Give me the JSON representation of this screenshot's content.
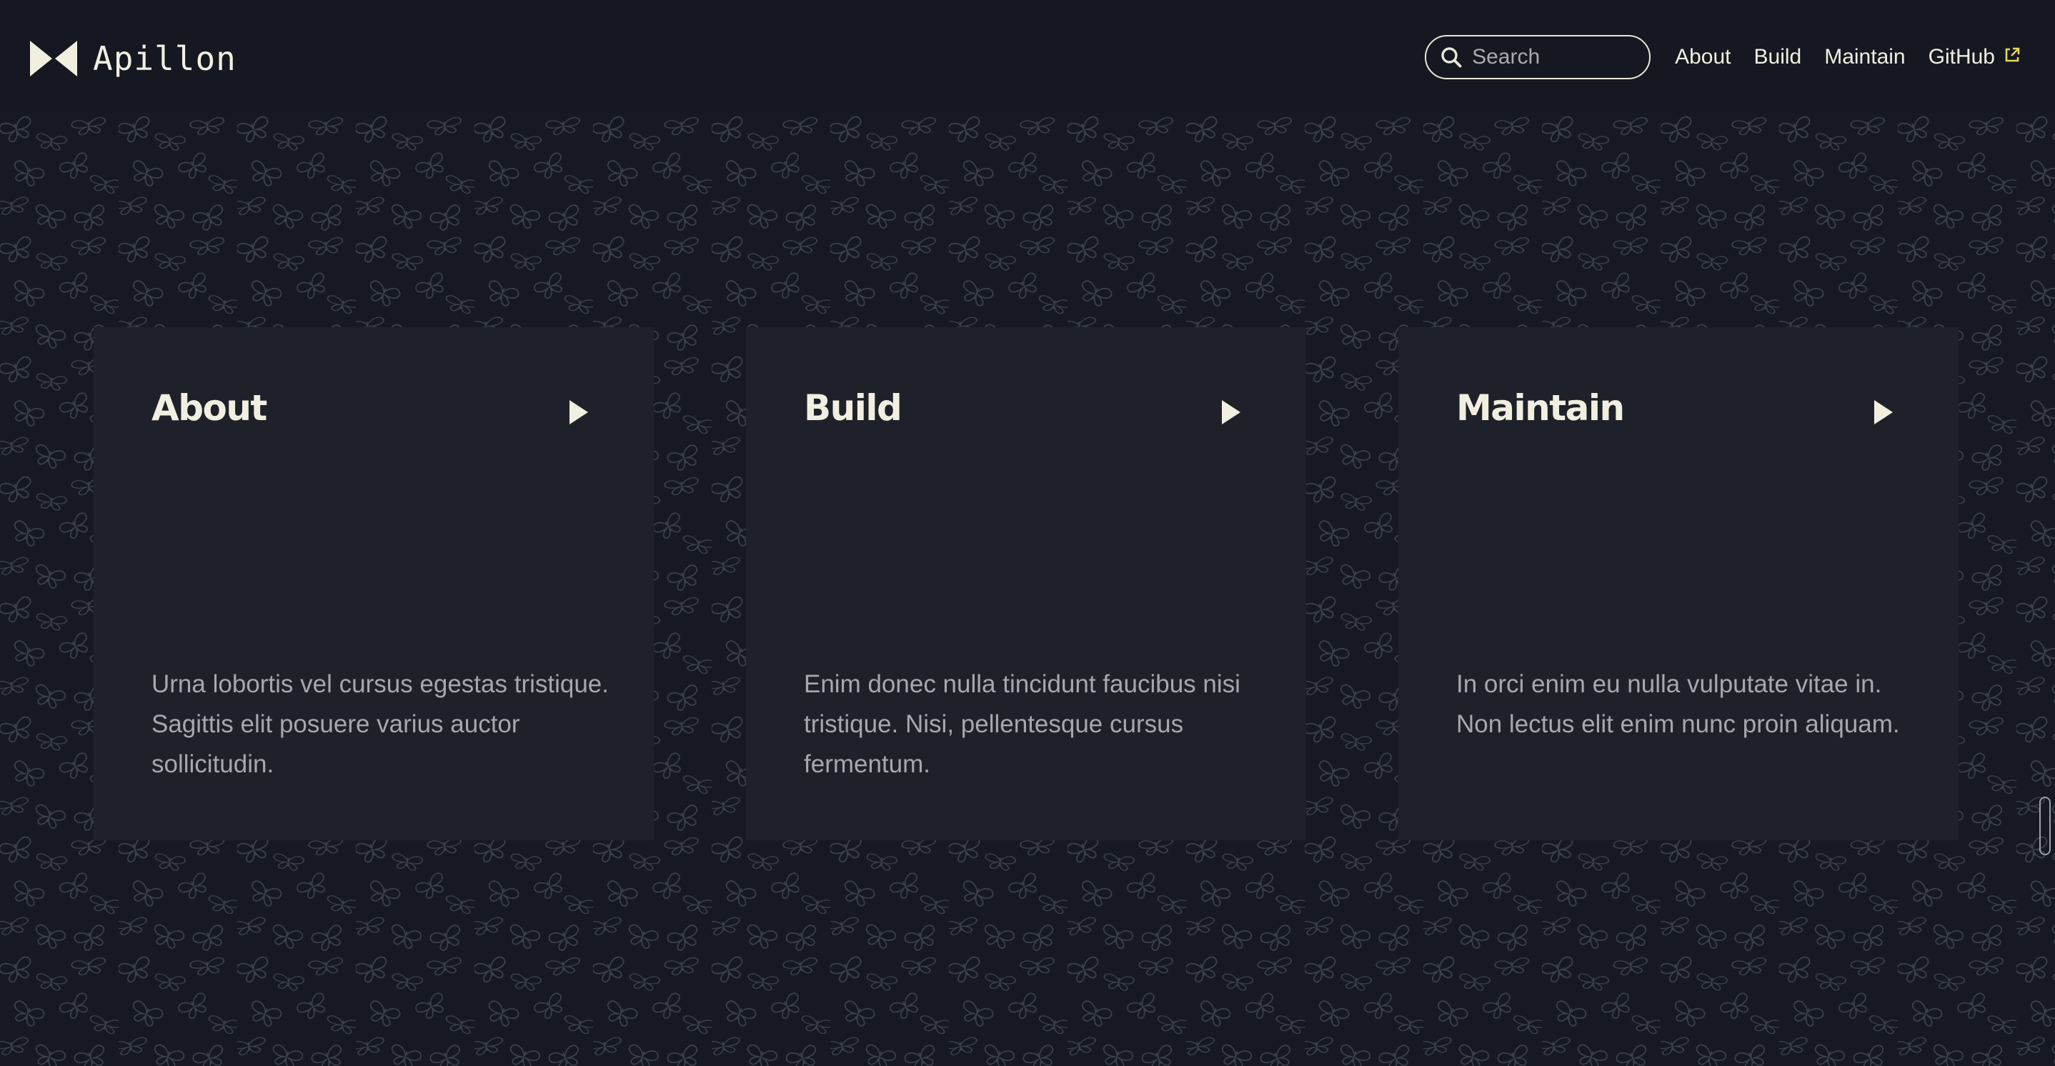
{
  "header": {
    "brand_name": "Apillon",
    "logo_icon": "bowtie-logo-icon",
    "search": {
      "placeholder": "Search",
      "value": "",
      "icon": "search-icon"
    },
    "nav": [
      {
        "label": "About"
      },
      {
        "label": "Build"
      },
      {
        "label": "Maintain"
      },
      {
        "label": "GitHub",
        "icon": "external-link-icon"
      }
    ]
  },
  "background": {
    "pattern_icon": "butterfly-pattern-icon",
    "color": "#161922"
  },
  "cards": [
    {
      "title": "About",
      "text": "Urna lobortis vel cursus egestas tristique. Sagittis elit posuere varius auctor sollicitudin.",
      "arrow_icon": "play-arrow-icon"
    },
    {
      "title": "Build",
      "text": "Enim donec nulla tincidunt faucibus nisi tristique. Nisi, pellentesque cursus fermentum.",
      "arrow_icon": "play-arrow-icon"
    },
    {
      "title": "Maintain",
      "text": "In orci enim eu nulla vulputate vitae in. Non lectus elit enim nunc proin aliquam.",
      "arrow_icon": "play-arrow-icon"
    }
  ],
  "colors": {
    "text_primary": "#F1EFE0",
    "text_muted": "#A6A8AD",
    "card_bg": "#1F212A",
    "header_bg": "#151821"
  }
}
